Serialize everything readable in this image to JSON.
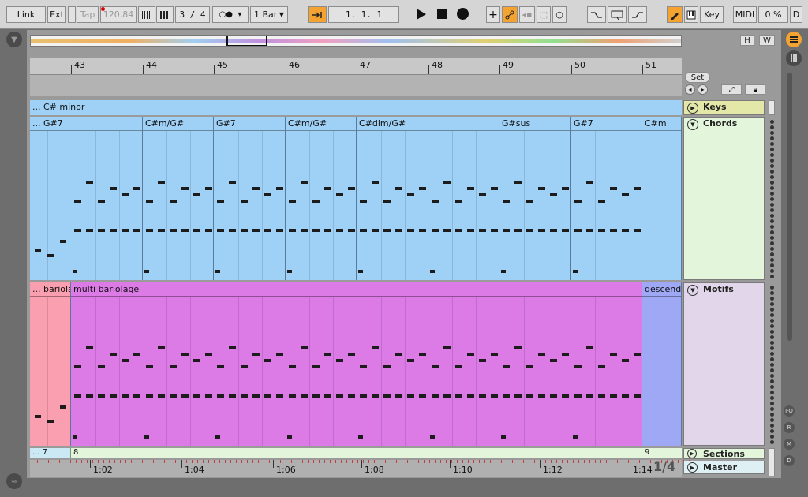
{
  "toolbar": {
    "link": "Link",
    "ext": "Ext",
    "tap": "Tap",
    "tempo": "120.84",
    "signature": "3 / 4",
    "quant": "1 Bar",
    "position": "1.   1.   1",
    "key": "Key",
    "midi": "MIDI",
    "cpu": "0 %",
    "d": "D"
  },
  "overview": {
    "h": "H",
    "w": "W"
  },
  "ruler": {
    "bars": [
      "43",
      "44",
      "45",
      "46",
      "47",
      "48",
      "49",
      "50",
      "51"
    ]
  },
  "set_button": "Set",
  "tracks": {
    "keys": {
      "name": "Keys",
      "clip": "... C# minor"
    },
    "chords": {
      "name": "Chords",
      "clips": [
        "... G#7",
        "C#m/G#",
        "G#7",
        "C#m/G#",
        "C#dim/G#",
        "G#sus",
        "G#7",
        "C#m"
      ]
    },
    "motifs": {
      "name": "Motifs",
      "clips": [
        "... bariola",
        "multi bariolage",
        "descend"
      ]
    },
    "sections": {
      "name": "Sections",
      "clips": [
        "... 7",
        "8",
        "9"
      ]
    },
    "master": {
      "name": "Master"
    }
  },
  "time_ruler": [
    "1:02",
    "1:04",
    "1:06",
    "1:08",
    "1:10",
    "1:12",
    "1:14"
  ],
  "page_indicator": "1/4",
  "side_buttons": [
    "I·O",
    "R",
    "M",
    "D"
  ],
  "colors": {
    "keys": "#9fd1f7",
    "chords": "#9fd1f7",
    "motifs": "#dc7ae6",
    "pink": "#f99fb0",
    "periwinkle": "#9fa8f5",
    "sections_bg": "#e3f5da",
    "accent": "#f5a330"
  }
}
